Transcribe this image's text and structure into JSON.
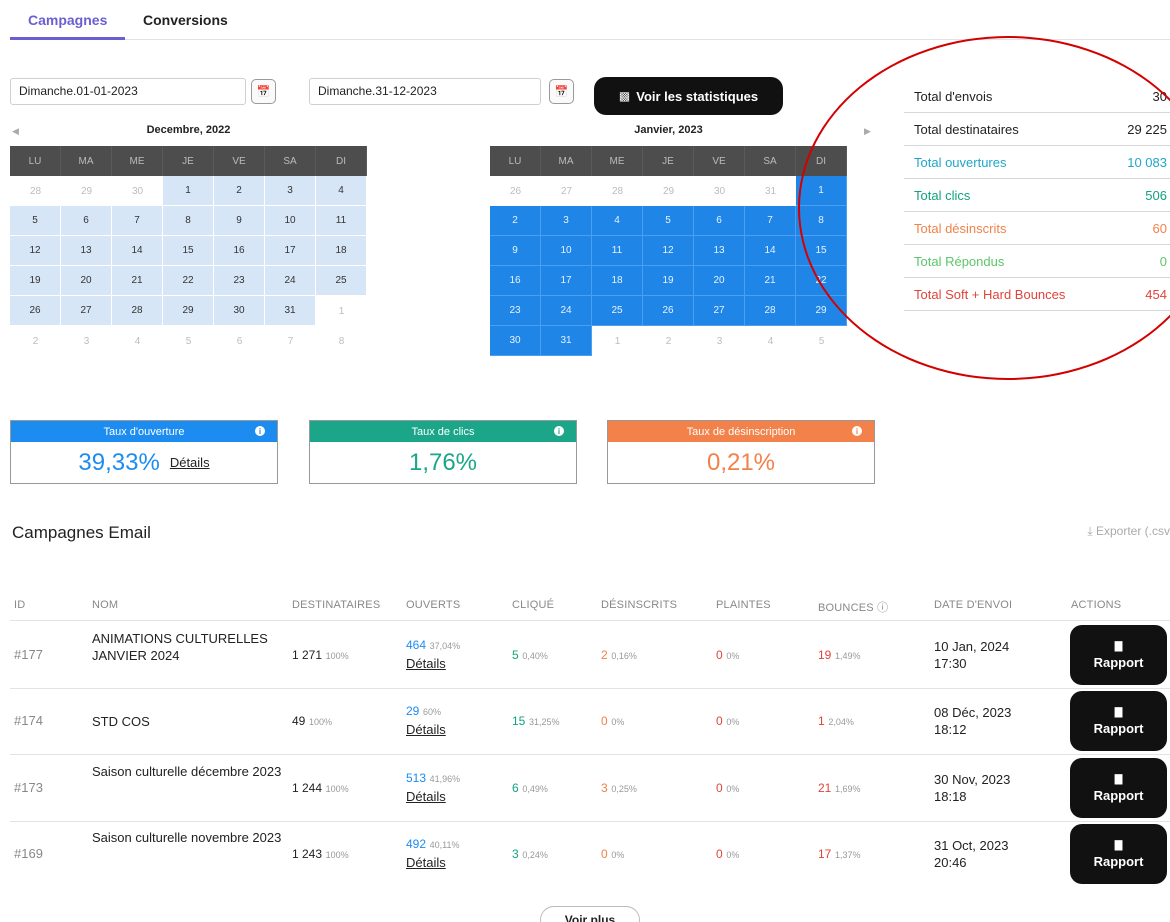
{
  "tabs": [
    "Campagnes",
    "Conversions"
  ],
  "date_from": "Dimanche.01-01-2023",
  "date_to": "Dimanche.31-12-2023",
  "stats_button": "Voir les statistiques",
  "calendar_left": {
    "title": "Decembre, 2022",
    "headers": [
      "LU",
      "MA",
      "ME",
      "JE",
      "VE",
      "SA",
      "DI"
    ],
    "days": [
      [
        "28",
        "m"
      ],
      [
        "29",
        "m"
      ],
      [
        "30",
        "m"
      ],
      [
        "1",
        "l"
      ],
      [
        "2",
        "l"
      ],
      [
        "3",
        "l"
      ],
      [
        "4",
        "l"
      ],
      [
        "5",
        "l"
      ],
      [
        "6",
        "l"
      ],
      [
        "7",
        "l"
      ],
      [
        "8",
        "l"
      ],
      [
        "9",
        "l"
      ],
      [
        "10",
        "l"
      ],
      [
        "11",
        "l"
      ],
      [
        "12",
        "l"
      ],
      [
        "13",
        "l"
      ],
      [
        "14",
        "l"
      ],
      [
        "15",
        "l"
      ],
      [
        "16",
        "l"
      ],
      [
        "17",
        "l"
      ],
      [
        "18",
        "l"
      ],
      [
        "19",
        "l"
      ],
      [
        "20",
        "l"
      ],
      [
        "21",
        "l"
      ],
      [
        "22",
        "l"
      ],
      [
        "23",
        "l"
      ],
      [
        "24",
        "l"
      ],
      [
        "25",
        "l"
      ],
      [
        "26",
        "l"
      ],
      [
        "27",
        "l"
      ],
      [
        "28",
        "l"
      ],
      [
        "29",
        "l"
      ],
      [
        "30",
        "l"
      ],
      [
        "31",
        "l"
      ],
      [
        "1",
        "m"
      ],
      [
        "2",
        "m"
      ],
      [
        "3",
        "m"
      ],
      [
        "4",
        "m"
      ],
      [
        "5",
        "m"
      ],
      [
        "6",
        "m"
      ],
      [
        "7",
        "m"
      ],
      [
        "8",
        "m"
      ]
    ]
  },
  "calendar_right": {
    "title": "Janvier, 2023",
    "headers": [
      "LU",
      "MA",
      "ME",
      "JE",
      "VE",
      "SA",
      "DI"
    ],
    "days": [
      [
        "26",
        "m"
      ],
      [
        "27",
        "m"
      ],
      [
        "28",
        "m"
      ],
      [
        "29",
        "m"
      ],
      [
        "30",
        "m"
      ],
      [
        "31",
        "m"
      ],
      [
        "1",
        "b"
      ],
      [
        "2",
        "b"
      ],
      [
        "3",
        "b"
      ],
      [
        "4",
        "b"
      ],
      [
        "5",
        "b"
      ],
      [
        "6",
        "b"
      ],
      [
        "7",
        "b"
      ],
      [
        "8",
        "b"
      ],
      [
        "9",
        "b"
      ],
      [
        "10",
        "b"
      ],
      [
        "11",
        "b"
      ],
      [
        "12",
        "b"
      ],
      [
        "13",
        "b"
      ],
      [
        "14",
        "b"
      ],
      [
        "15",
        "b"
      ],
      [
        "16",
        "b"
      ],
      [
        "17",
        "b"
      ],
      [
        "18",
        "b"
      ],
      [
        "19",
        "b"
      ],
      [
        "20",
        "b"
      ],
      [
        "21",
        "b"
      ],
      [
        "22",
        "b"
      ],
      [
        "23",
        "b"
      ],
      [
        "24",
        "b"
      ],
      [
        "25",
        "b"
      ],
      [
        "26",
        "b"
      ],
      [
        "27",
        "b"
      ],
      [
        "28",
        "b"
      ],
      [
        "29",
        "b"
      ],
      [
        "30",
        "b"
      ],
      [
        "31",
        "b"
      ],
      [
        "1",
        "m"
      ],
      [
        "2",
        "m"
      ],
      [
        "3",
        "m"
      ],
      [
        "4",
        "m"
      ],
      [
        "5",
        "m"
      ]
    ]
  },
  "totals": [
    {
      "label": "Total d'envois",
      "value": "30",
      "color": "#222222"
    },
    {
      "label": "Total destinataires",
      "value": "29 225",
      "color": "#222222"
    },
    {
      "label": "Total ouvertures",
      "value": "10 083",
      "color": "#20a6c9"
    },
    {
      "label": "Total clics",
      "value": "506",
      "color": "#11a37f"
    },
    {
      "label": "Total désinscrits",
      "value": "60",
      "color": "#f0824a"
    },
    {
      "label": "Total Répondus",
      "value": "0",
      "color": "#5cc66a"
    },
    {
      "label": "Total Soft + Hard Bounces",
      "value": "454",
      "color": "#e0443a"
    }
  ],
  "rates": [
    {
      "label": "Taux d'ouverture",
      "value": "39,33%",
      "details": "Détails",
      "color": "#1d8cf0"
    },
    {
      "label": "Taux de clics",
      "value": "1,76%",
      "details": "",
      "color": "#1ba68a"
    },
    {
      "label": "Taux de désinscription",
      "value": "0,21%",
      "details": "",
      "color": "#f2814a"
    }
  ],
  "campaigns_title": "Campagnes Email",
  "export_label": "Exporter (.csv",
  "columns": [
    "ID",
    "NOM",
    "DESTINATAIRES",
    "OUVERTS",
    "CLIQUÉ",
    "DÉSINSCRITS",
    "PLAINTES",
    "BOUNCES",
    "DATE D'ENVOI",
    "ACTIONS"
  ],
  "rows": [
    {
      "id": "#177",
      "name": "ANIMATIONS CULTURELLES JANVIER 2024",
      "dest": "1 271",
      "dest_pct": "100%",
      "open": "464",
      "open_pct": "37,04%",
      "click": "5",
      "click_pct": "0,40%",
      "unsub": "2",
      "unsub_pct": "0,16%",
      "compl": "0",
      "compl_pct": "0%",
      "bounce": "19",
      "bounce_pct": "1,49%",
      "date": "10 Jan, 2024",
      "time": "17:30"
    },
    {
      "id": "#174",
      "name": "STD COS",
      "dest": "49",
      "dest_pct": "100%",
      "open": "29",
      "open_pct": "60%",
      "click": "15",
      "click_pct": "31,25%",
      "unsub": "0",
      "unsub_pct": "0%",
      "compl": "0",
      "compl_pct": "0%",
      "bounce": "1",
      "bounce_pct": "2,04%",
      "date": "08 Déc, 2023",
      "time": "18:12"
    },
    {
      "id": "#173",
      "name": "Saison culturelle décembre 2023",
      "dest": "1 244",
      "dest_pct": "100%",
      "open": "513",
      "open_pct": "41,96%",
      "click": "6",
      "click_pct": "0,49%",
      "unsub": "3",
      "unsub_pct": "0,25%",
      "compl": "0",
      "compl_pct": "0%",
      "bounce": "21",
      "bounce_pct": "1,69%",
      "date": "30 Nov, 2023",
      "time": "18:18"
    },
    {
      "id": "#169",
      "name": "Saison culturelle novembre 2023",
      "dest": "1 243",
      "dest_pct": "100%",
      "open": "492",
      "open_pct": "40,11%",
      "click": "3",
      "click_pct": "0,24%",
      "unsub": "0",
      "unsub_pct": "0%",
      "compl": "0",
      "compl_pct": "0%",
      "bounce": "17",
      "bounce_pct": "1,37%",
      "date": "31 Oct, 2023",
      "time": "20:46"
    }
  ],
  "details_label": "Détails",
  "rapport_label": "Rapport",
  "voir_plus": "Voir plus"
}
